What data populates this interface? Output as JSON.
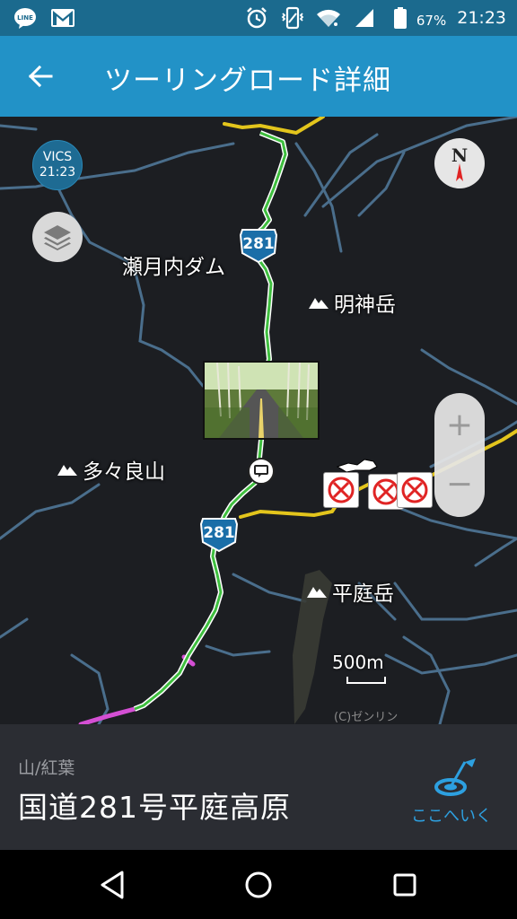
{
  "status_bar": {
    "battery_percent": "67%",
    "time": "21:23",
    "icons": [
      "line-icon",
      "gmail-icon",
      "alarm-icon",
      "vibrate-icon",
      "wifi-icon",
      "signal-icon",
      "battery-icon"
    ]
  },
  "app_bar": {
    "title": "ツーリングロード詳細",
    "back_icon": "back-arrow-icon"
  },
  "map": {
    "vics": {
      "label": "VICS",
      "time": "21:23"
    },
    "labels": {
      "dam": "瀬月内ダム",
      "myojin": "明神岳",
      "tatara": "多々良山",
      "hiraniwa": "平庭岳"
    },
    "route_number": "281",
    "zoom_in": "+",
    "zoom_out": "−",
    "scale": "500m",
    "copyright": "(C)ゼンリン",
    "colors": {
      "route": "#3fbf3f",
      "route_outline": "#ffffff",
      "road_yellow": "#e3c51c",
      "road_magenta": "#d44fd4",
      "river": "#4a6e8c"
    }
  },
  "info_panel": {
    "category": "山/紅葉",
    "name": "国道281号平庭高原",
    "go_here_label": "ここへいく"
  },
  "nav_bar": {
    "icons": [
      "back-triangle-icon",
      "home-circle-icon",
      "recents-square-icon"
    ]
  }
}
